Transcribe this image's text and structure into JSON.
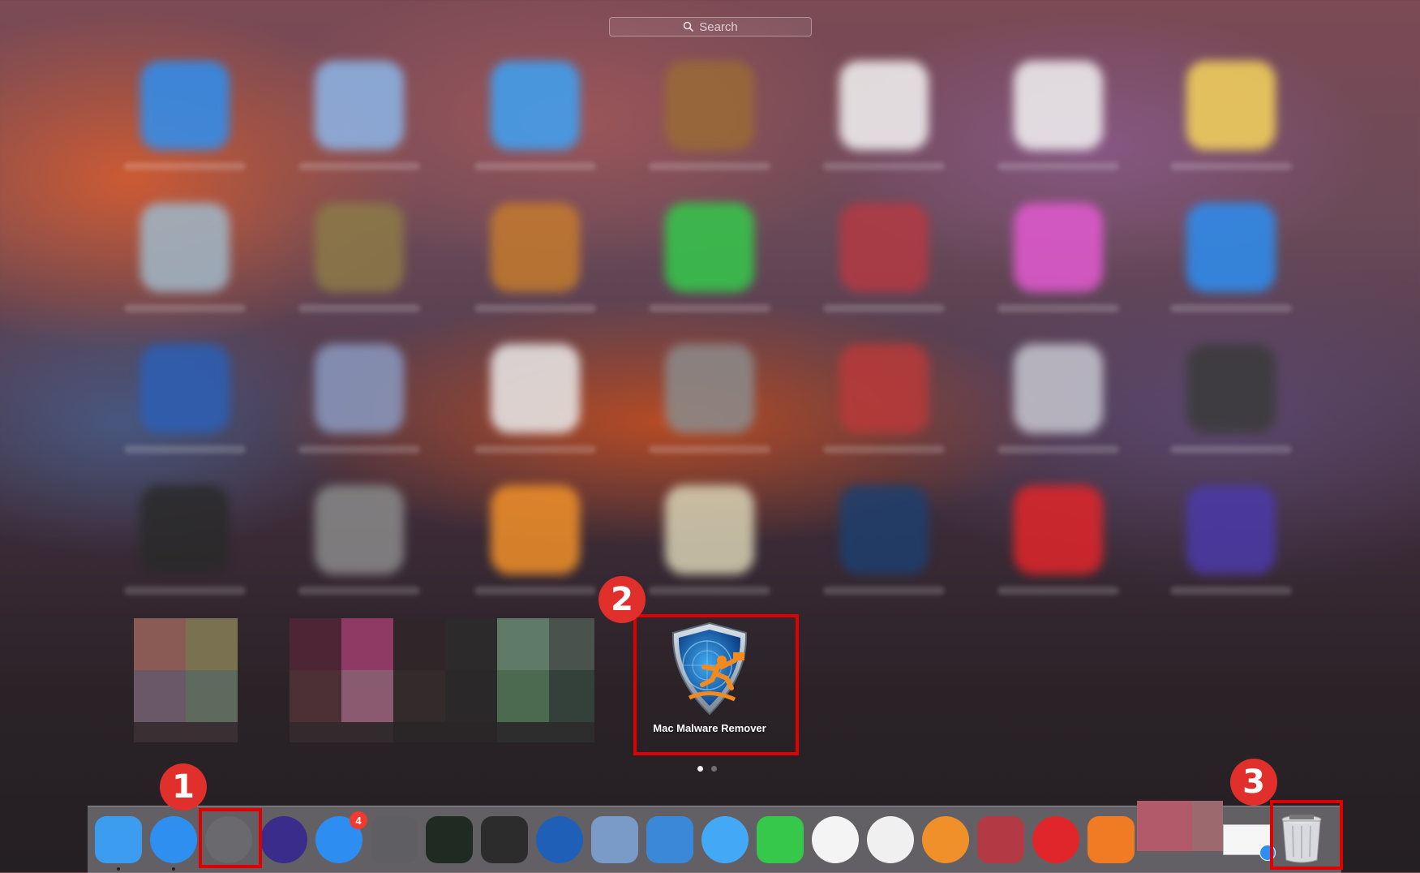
{
  "search": {
    "placeholder": "Search"
  },
  "launchpad": {
    "grid_rows": [
      [
        {
          "icon": "safari-icon",
          "color": "#2f8ff0"
        },
        {
          "icon": "mail-icon",
          "color": "#8cb6e8"
        },
        {
          "icon": "messages-icon",
          "color": "#3ea2f5"
        },
        {
          "icon": "contacts-icon",
          "color": "#9a6a36"
        },
        {
          "icon": "calendar-icon",
          "color": "#f4f4f4"
        },
        {
          "icon": "reminders-icon",
          "color": "#f2f2f2"
        },
        {
          "icon": "notes-icon",
          "color": "#f5d45c"
        }
      ],
      [
        {
          "icon": "photo-booth-icon",
          "color": "#9fb8c8"
        },
        {
          "icon": "imovie-icon",
          "color": "#8c7a48"
        },
        {
          "icon": "garageband-icon",
          "color": "#c47a2e"
        },
        {
          "icon": "facetime-icon",
          "color": "#35c84a"
        },
        {
          "icon": "photo-collage-icon",
          "color": "#b33a44"
        },
        {
          "icon": "itunes-icon",
          "color": "#e25ad0"
        },
        {
          "icon": "app-store-icon",
          "color": "#2d8df0"
        }
      ],
      [
        {
          "icon": "quicktime-icon",
          "color": "#2c5fb4"
        },
        {
          "icon": "preview-icon",
          "color": "#8a9ac0"
        },
        {
          "icon": "textedit-icon",
          "color": "#eaeaea"
        },
        {
          "icon": "calculator-icon",
          "color": "#8b8b8b"
        },
        {
          "icon": "dictionary-icon",
          "color": "#b83a3a"
        },
        {
          "icon": "other-folder-icon",
          "color": "#c6c6d0"
        },
        {
          "icon": "mission-control-icon",
          "color": "#3b3b3b"
        }
      ],
      [
        {
          "icon": "dashboard-icon",
          "color": "#2a2a2a"
        },
        {
          "icon": "system-preferences-icon",
          "color": "#8a8a8a"
        },
        {
          "icon": "ibooks-icon",
          "color": "#f0902a"
        },
        {
          "icon": "maps-icon",
          "color": "#d8d2b4"
        },
        {
          "icon": "steam-icon",
          "color": "#1e3f6e"
        },
        {
          "icon": "screen-recorder-icon",
          "color": "#e0262a"
        },
        {
          "icon": "siri-icon",
          "color": "#4b3aa8"
        }
      ]
    ],
    "highlighted_app": {
      "label": "Mac Malware Remover"
    },
    "steps": {
      "one": "1",
      "two": "2",
      "three": "3"
    }
  },
  "dock": {
    "apps": [
      {
        "name": "finder-icon",
        "color": "#3c9df0"
      },
      {
        "name": "safari-icon",
        "color": "#2f8ff0"
      },
      {
        "name": "launchpad-icon",
        "color": "#6a6a6e"
      },
      {
        "name": "siri-icon",
        "color": "#3a2c8a"
      },
      {
        "name": "app-store-icon",
        "color": "#2d8df0",
        "badge": "4"
      },
      {
        "name": "system-preferences-icon",
        "color": "#5f5f63"
      },
      {
        "name": "activity-monitor-icon",
        "color": "#1f2a22"
      },
      {
        "name": "mission-control-icon",
        "color": "#2c2c2c"
      },
      {
        "name": "quicktime-icon",
        "color": "#1f5fb8"
      },
      {
        "name": "preview-icon",
        "color": "#7a9ac8"
      },
      {
        "name": "xcode-icon",
        "color": "#3b88d8"
      },
      {
        "name": "messages-icon",
        "color": "#43a9f7"
      },
      {
        "name": "facetime-icon",
        "color": "#35c84a"
      },
      {
        "name": "photos-icon",
        "color": "#f4f4f4"
      },
      {
        "name": "itunes-icon",
        "color": "#f0f0f0"
      },
      {
        "name": "ibooks-icon",
        "color": "#f0902a"
      },
      {
        "name": "photo-collage-icon",
        "color": "#b33a44"
      },
      {
        "name": "screen-recorder-icon",
        "color": "#e0262a"
      },
      {
        "name": "sublime-icon",
        "color": "#f07b24"
      }
    ]
  }
}
